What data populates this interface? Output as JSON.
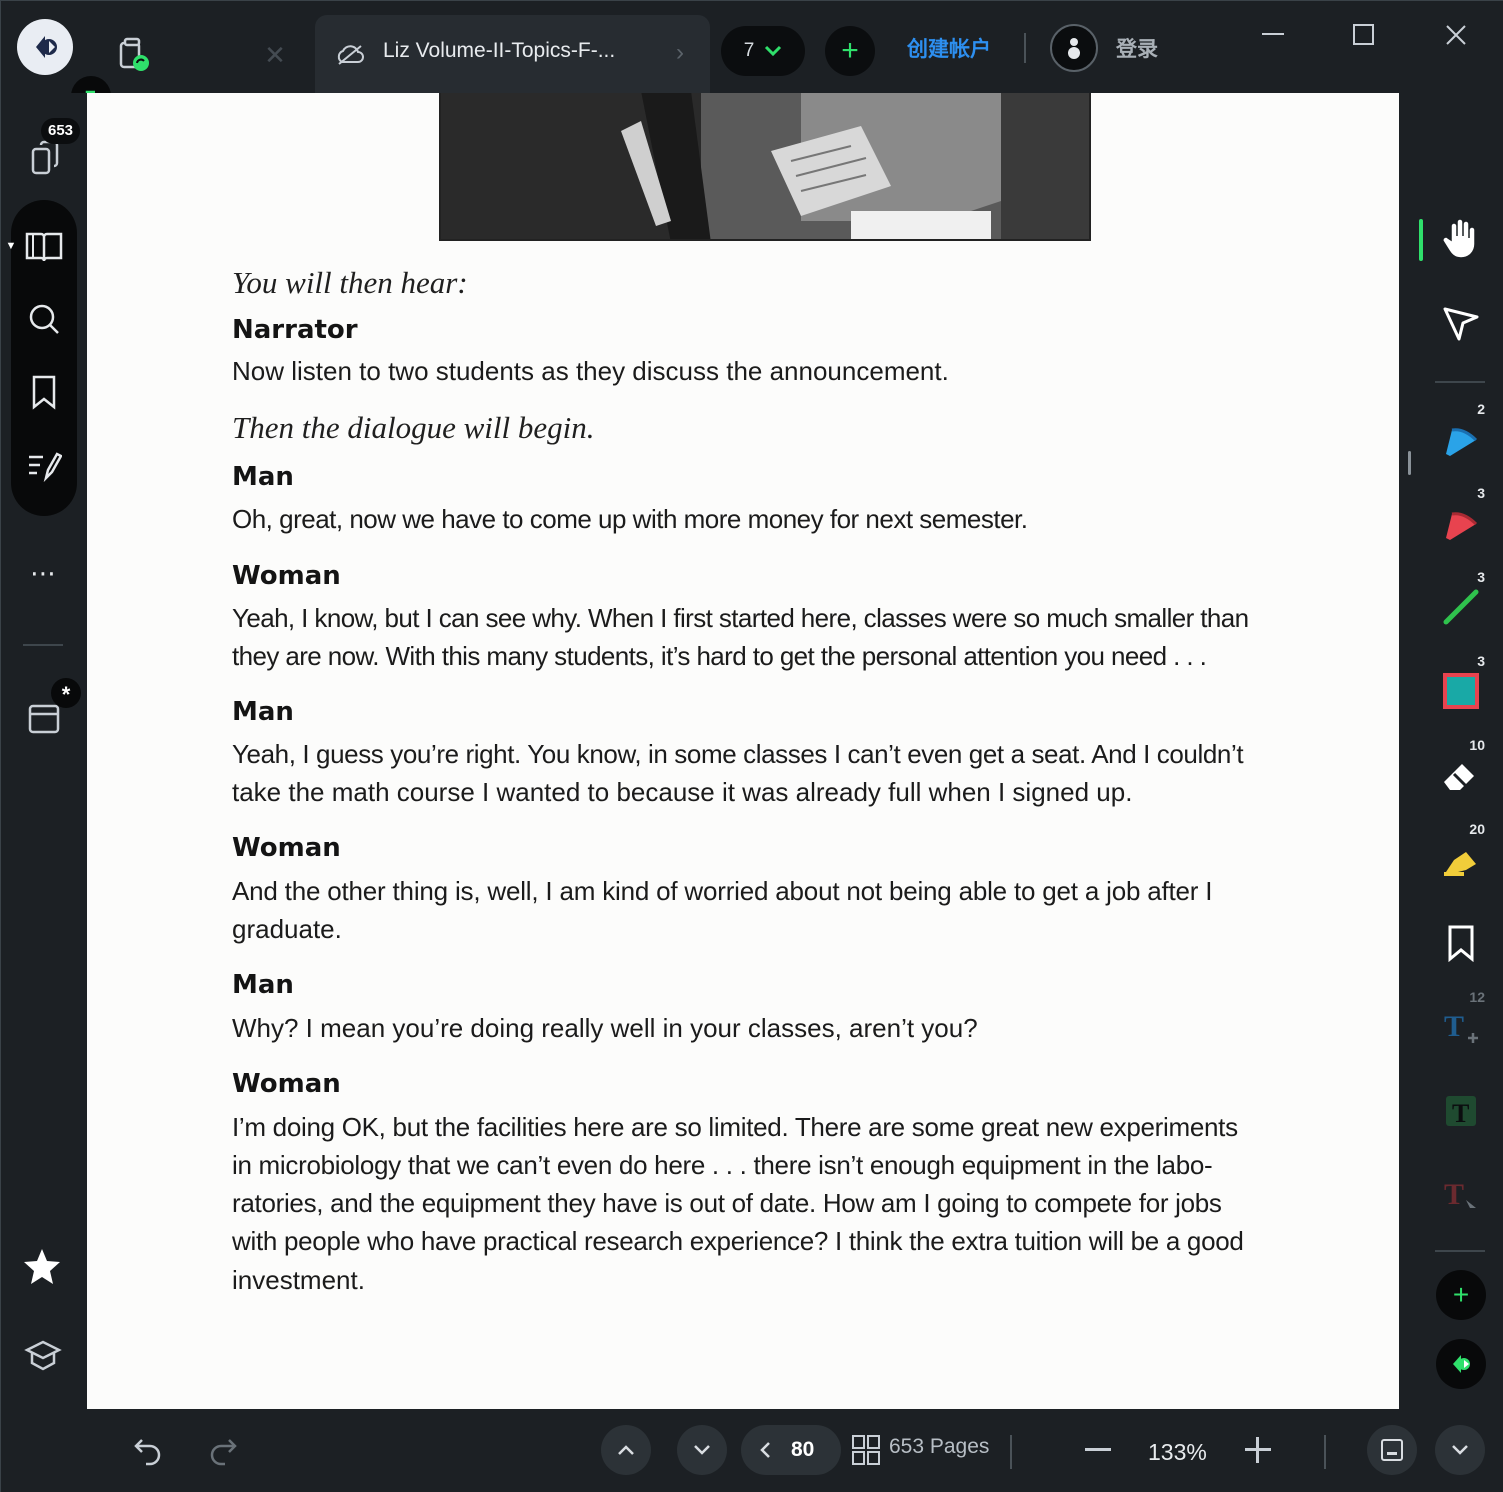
{
  "titlebar": {
    "tab_title": "Liz Volume-II-Topics-F-...",
    "tab_count": "7",
    "create_account": "创建帐户",
    "login": "登录"
  },
  "sidebar": {
    "page_count_badge": "653",
    "new_badge": "*"
  },
  "document": {
    "intro": "You will then hear:",
    "blocks": [
      {
        "speaker": "Narrator",
        "lines": [
          "Now listen to two students as they discuss the announcement."
        ]
      },
      {
        "note": "Then the dialogue will begin."
      },
      {
        "speaker": "Man",
        "lines": [
          "Oh, great, now we have to come up with more money for next semester."
        ]
      },
      {
        "speaker": "Woman",
        "lines": [
          "Yeah, I know, but I can see why. When I first started here, classes were so much smaller than",
          "they are now. With this many students, it’s hard to get the personal attention you need . . ."
        ]
      },
      {
        "speaker": "Man",
        "lines": [
          "Yeah, I guess you’re right. You know, in some classes I can’t even get a seat. And I couldn’t",
          "take the math course I wanted to because it was already full when I signed up."
        ]
      },
      {
        "speaker": "Woman",
        "lines": [
          "And the other thing is, well, I am kind of worried about not being able to get a job after I",
          "graduate."
        ]
      },
      {
        "speaker": "Man",
        "lines": [
          "Why? I mean you’re doing really well in your classes, aren’t you?"
        ]
      },
      {
        "speaker": "Woman",
        "lines": [
          "I’m doing OK, but the facilities here are so limited. There are some great new experiments",
          "in microbiology that we can’t even do here . . . there isn’t enough equipment in the labo-",
          "ratories, and the equipment they have is out of date. How am I going to compete for jobs",
          "with people who have practical research experience? I think the extra tuition will be a good",
          "investment."
        ]
      }
    ]
  },
  "tools": {
    "pen_blue_count": "2",
    "pen_red_count": "3",
    "line_count": "3",
    "rect_count": "3",
    "eraser_count": "10",
    "highlighter_count": "20",
    "text_add_count": "12"
  },
  "colors": {
    "accent_green": "#2fe06b",
    "link_blue": "#2d8ff0",
    "tool_blue": "#2aa3e8",
    "tool_red": "#e8434f",
    "tool_teal": "#19a9a6",
    "tool_yellow": "#f1cd3a"
  },
  "bottombar": {
    "current_page": "80",
    "pages_label": "653 Pages",
    "zoom": "133%"
  }
}
